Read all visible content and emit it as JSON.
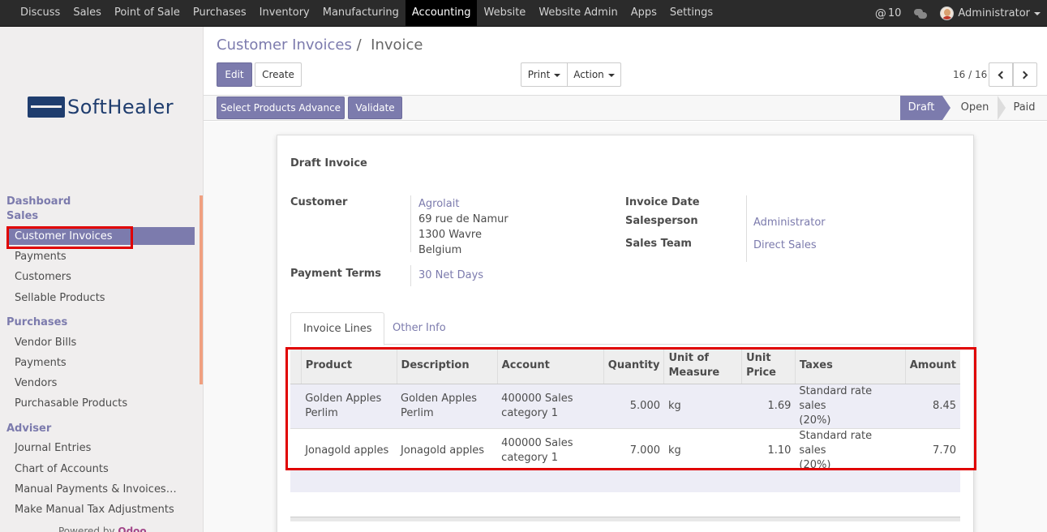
{
  "topnav": {
    "items": [
      "Discuss",
      "Sales",
      "Point of Sale",
      "Purchases",
      "Inventory",
      "Manufacturing",
      "Accounting",
      "Website",
      "Website Admin",
      "Apps",
      "Settings"
    ],
    "active": "Accounting",
    "mentions_count": "10",
    "user": "Administrator"
  },
  "logo": {
    "text": "SoftHealer"
  },
  "sidebar": {
    "dashboard": "Dashboard",
    "sales_head": "Sales",
    "sales_items": [
      "Customer Invoices",
      "Payments",
      "Customers",
      "Sellable Products"
    ],
    "purchases_head": "Purchases",
    "purchases_items": [
      "Vendor Bills",
      "Payments",
      "Vendors",
      "Purchasable Products"
    ],
    "adviser_head": "Adviser",
    "adviser_items": [
      "Journal Entries",
      "Chart of Accounts",
      "Manual Payments & Invoices…",
      "Make Manual Tax Adjustments"
    ],
    "powered_by": "Powered by",
    "powered_brand": "Odoo"
  },
  "breadcrumb": {
    "parent": "Customer Invoices",
    "separator": "/",
    "current": "Invoice"
  },
  "buttons": {
    "edit": "Edit",
    "create": "Create",
    "print": "Print",
    "action": "Action",
    "select_products": "Select Products Advance",
    "validate": "Validate"
  },
  "pager": {
    "value": "16 / 16"
  },
  "stages": [
    "Draft",
    "Open",
    "Paid"
  ],
  "invoice": {
    "title": "Draft Invoice",
    "customer_label": "Customer",
    "customer_name": "Agrolait",
    "address_line1": "69 rue de Namur",
    "address_line2": "1300 Wavre",
    "address_line3": "Belgium",
    "payment_terms_label": "Payment Terms",
    "payment_terms": "30 Net Days",
    "invoice_date_label": "Invoice Date",
    "salesperson_label": "Salesperson",
    "salesperson": "Administrator",
    "sales_team_label": "Sales Team",
    "sales_team": "Direct Sales"
  },
  "tabs": [
    "Invoice Lines",
    "Other Info"
  ],
  "lines": {
    "headers": {
      "product": "Product",
      "description": "Description",
      "account": "Account",
      "quantity": "Quantity",
      "uom_1": "Unit of",
      "uom_2": "Measure",
      "price_1": "Unit",
      "price_2": "Price",
      "taxes": "Taxes",
      "amount": "Amount"
    },
    "rows": [
      {
        "product_1": "Golden Apples",
        "product_2": "Perlim",
        "description_1": "Golden Apples",
        "description_2": "Perlim",
        "account_1": "400000 Sales",
        "account_2": "category 1",
        "quantity": "5.000",
        "uom": "kg",
        "price": "1.69",
        "taxes_1": "Standard rate sales",
        "taxes_2": "(20%)",
        "amount": "8.45"
      },
      {
        "product": "Jonagold apples",
        "description": "Jonagold apples",
        "account_1": "400000 Sales",
        "account_2": "category 1",
        "quantity": "7.000",
        "uom": "kg",
        "price": "1.10",
        "taxes_1": "Standard rate sales",
        "taxes_2": "(20%)",
        "amount": "7.70"
      }
    ]
  },
  "colors": {
    "brand": "#7c7bad",
    "navbar": "#2b2b2b",
    "highlight": "#e00000"
  }
}
